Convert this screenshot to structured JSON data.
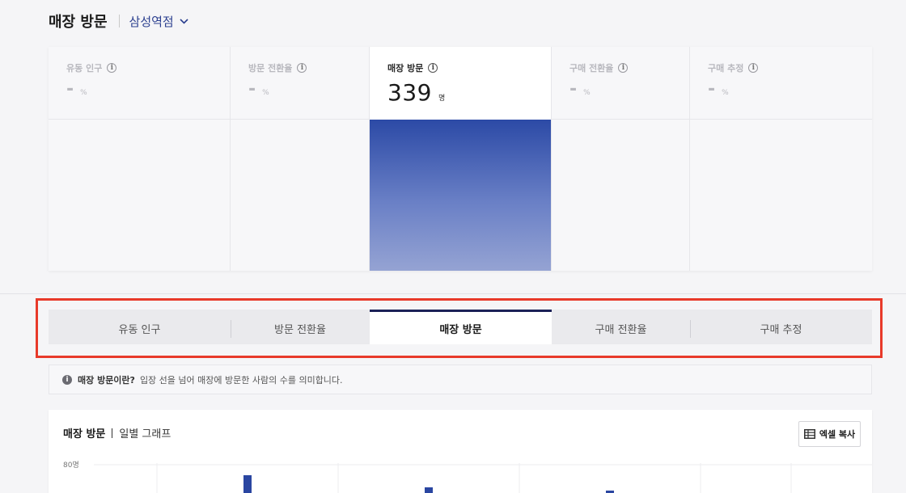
{
  "header": {
    "title": "매장 방문",
    "store": "삼성역점",
    "dropdown_icon": "chevron-down-icon"
  },
  "funnel": [
    {
      "label": "유동 인구",
      "value": "-",
      "unit": "%",
      "active": false
    },
    {
      "label": "방문 전환율",
      "value": "-",
      "unit": "%",
      "active": false
    },
    {
      "label": "매장 방문",
      "value": "339",
      "unit": "명",
      "active": true,
      "fill_fraction": 1.0
    },
    {
      "label": "구매 전환율",
      "value": "-",
      "unit": "%",
      "active": false
    },
    {
      "label": "구매 추정",
      "value": "-",
      "unit": "%",
      "active": false
    }
  ],
  "info_icon_text": "i",
  "tabs": [
    {
      "label": "유동 인구",
      "active": false
    },
    {
      "label": "방문 전환율",
      "active": false
    },
    {
      "label": "매장 방문",
      "active": true
    },
    {
      "label": "구매 전환율",
      "active": false
    },
    {
      "label": "구매 추정",
      "active": false
    }
  ],
  "info_banner": {
    "term": "매장 방문이란?",
    "description": "입장 선을 넘어 매장에 방문한 사람의 수를 의미합니다."
  },
  "chart_section": {
    "title": "매장 방문",
    "subtitle": "일별 그래프",
    "excel_button": "엑셀 복사"
  },
  "chart_data": {
    "type": "bar",
    "ytick_labels": [
      "80명"
    ],
    "ylim": [
      0,
      80
    ],
    "grid": true,
    "series_color": "#2a46a1"
  },
  "colors": {
    "accent": "#2a46a1",
    "tab_active_border": "#1b2157",
    "highlight": "#e83a2a"
  }
}
